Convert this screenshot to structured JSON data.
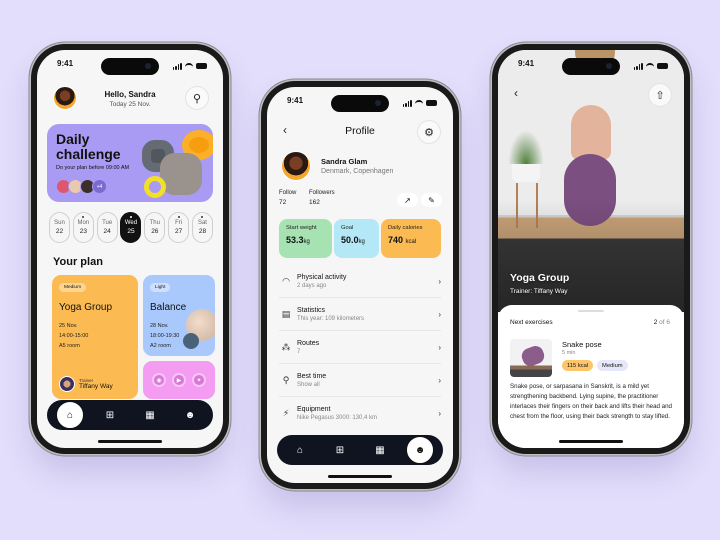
{
  "status_time": "9:41",
  "colors": {
    "background": "#e3defb",
    "challenge": "#a99af3",
    "yoga_card": "#fbbb52",
    "balance_card": "#a9c9fd",
    "social_card": "#f49cf2",
    "nav": "#0f1420",
    "start_weight": "#a7e3b2",
    "goal": "#b4e8f6",
    "calories": "#fbbb52"
  },
  "home": {
    "greeting": "Hello, Sandra",
    "date": "Today 25 Nov.",
    "search_icon": "search-icon",
    "challenge": {
      "title_line1": "Daily",
      "title_line2": "challenge",
      "subtitle": "Do your plan before 09:00 AM",
      "extra_count": "+4"
    },
    "days": [
      {
        "name": "Sun",
        "num": "22",
        "dot": false,
        "active": false
      },
      {
        "name": "Mon",
        "num": "23",
        "dot": true,
        "active": false
      },
      {
        "name": "Tue",
        "num": "24",
        "dot": false,
        "active": false
      },
      {
        "name": "Wed",
        "num": "25",
        "dot": true,
        "active": true
      },
      {
        "name": "Thu",
        "num": "26",
        "dot": false,
        "active": false
      },
      {
        "name": "Fri",
        "num": "27",
        "dot": true,
        "active": false
      },
      {
        "name": "Sat",
        "num": "28",
        "dot": true,
        "active": false
      }
    ],
    "plan_heading": "Your plan",
    "yoga": {
      "level": "Medium",
      "title": "Yoga Group",
      "date": "25 Nov.",
      "time": "14:00-15:00",
      "room": "A5 room",
      "trainer_label": "Trainer",
      "trainer_name": "Tiffany Way"
    },
    "balance": {
      "level": "Light",
      "title": "Balance",
      "date": "28 Nov.",
      "time": "18:00-19:30",
      "room": "A2 room"
    },
    "social": [
      "instagram-icon",
      "youtube-icon",
      "twitter-icon"
    ],
    "nav": [
      "home",
      "apps",
      "stats",
      "profile"
    ],
    "nav_active": "home"
  },
  "profile": {
    "title": "Profile",
    "name": "Sandra Glam",
    "location": "Denmark, Copenhagen",
    "follow_label": "Follow",
    "follow_value": "72",
    "followers_label": "Followers",
    "followers_value": "162",
    "stats": [
      {
        "label": "Start weight",
        "value": "53.3",
        "unit": "kg"
      },
      {
        "label": "Goal",
        "value": "50.0",
        "unit": "kg"
      },
      {
        "label": "Daily calories",
        "value": "740",
        "unit": "kcal"
      }
    ],
    "rows": [
      {
        "icon": "activity-icon",
        "title": "Physical activity",
        "sub": "2 days ago"
      },
      {
        "icon": "statistics-icon",
        "title": "Statistics",
        "sub": "This year: 109 kilometers"
      },
      {
        "icon": "routes-icon",
        "title": "Routes",
        "sub": "7"
      },
      {
        "icon": "trophy-icon",
        "title": "Best time",
        "sub": "Show all"
      },
      {
        "icon": "equipment-icon",
        "title": "Equipment",
        "sub": "Nike Pegasus 3000: 130,4 km"
      }
    ],
    "nav_active": "profile"
  },
  "detail": {
    "title": "Yoga Group",
    "trainer": "Trainer: Tiffany Way",
    "next_label": "Next exercises",
    "current": "2",
    "total_text": "of 6",
    "exercise": {
      "name": "Snake pose",
      "duration": "5 min",
      "kcal": "115 kcal",
      "level": "Medium"
    },
    "description": "Snake pose, or sarpasana in Sanskrit, is a mild yet strengthening backbend. Lying supine, the practitioner interlaces their fingers on their back and lifts their head and chest from the floor, using their back strength to stay lifted."
  }
}
